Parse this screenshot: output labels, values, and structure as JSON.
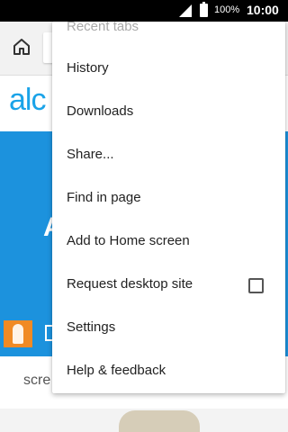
{
  "status_bar": {
    "battery_percent": "100%",
    "time": "10:00",
    "signal_icon": "signal-icon",
    "battery_icon": "battery-icon"
  },
  "toolbar": {
    "home_icon": "home-icon"
  },
  "page_background": {
    "logo_text": "alc",
    "hero_letter": "A",
    "text_fragment": "scre",
    "accent_color": "#1c92dd"
  },
  "menu": {
    "items": [
      {
        "label": "Recent tabs"
      },
      {
        "label": "History"
      },
      {
        "label": "Downloads"
      },
      {
        "label": "Share..."
      },
      {
        "label": "Find in page"
      },
      {
        "label": "Add to Home screen"
      },
      {
        "label": "Request desktop site",
        "checkbox": false
      },
      {
        "label": "Settings"
      },
      {
        "label": "Help & feedback"
      }
    ]
  }
}
